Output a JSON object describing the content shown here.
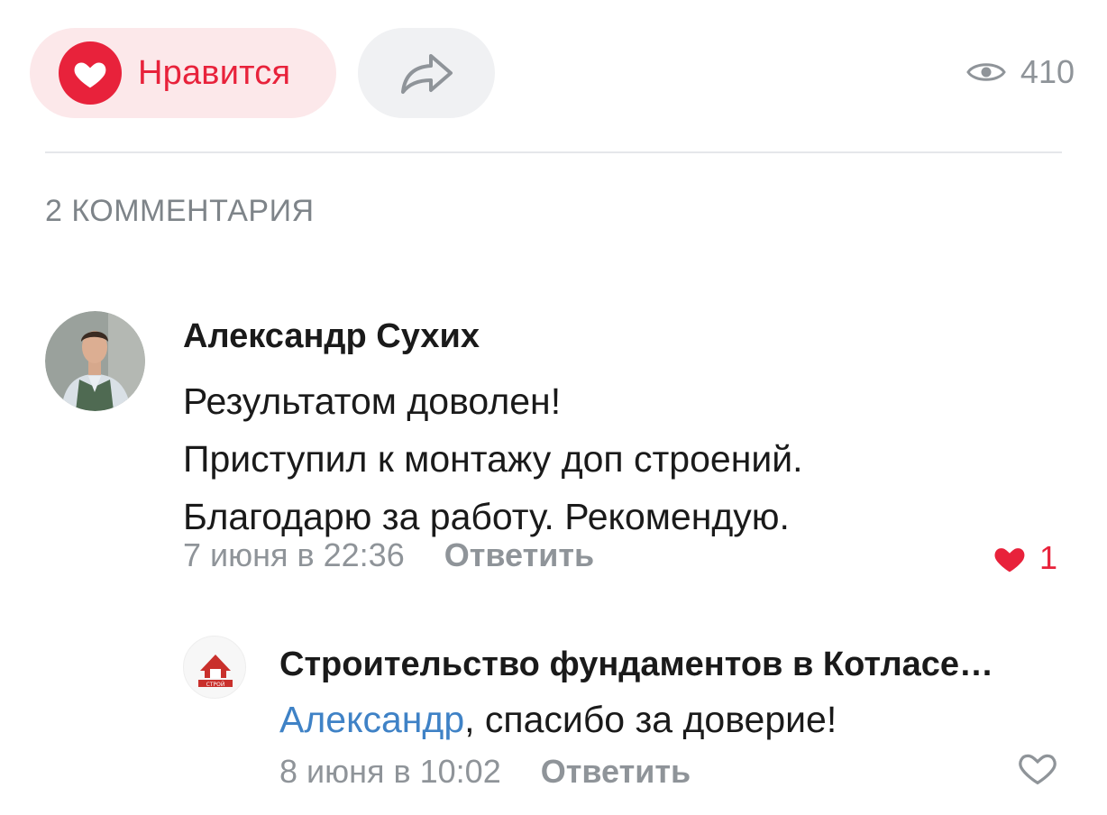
{
  "actions": {
    "like_label": "Нравится",
    "views_count": "410",
    "accent_color": "#e8223b"
  },
  "comments_header": "2 КОММЕНТАРИЯ",
  "comments": [
    {
      "author": "Александр Сухих",
      "lines": [
        "Результатом доволен!",
        "Приступил к монтажу доп строений.",
        "Благодарю за работу. Рекомендую."
      ],
      "date": "7 июня в 22:36",
      "reply_label": "Ответить",
      "likes": "1",
      "liked": true
    },
    {
      "author": "Строительство фундаментов в Котласе…",
      "mention": "Александр",
      "text_rest": ", спасибо за доверие!",
      "date": "8 июня в 10:02",
      "reply_label": "Ответить",
      "liked": false,
      "avatar_logo_text": "СТРОЙ"
    }
  ]
}
